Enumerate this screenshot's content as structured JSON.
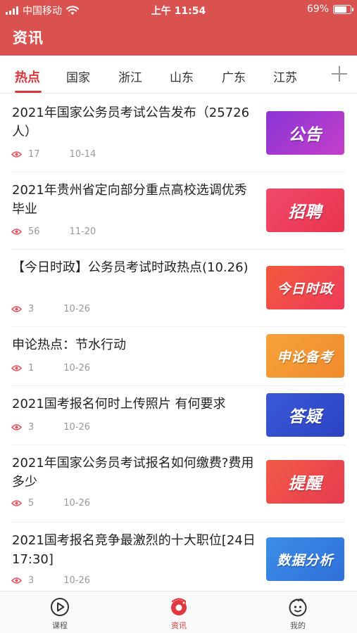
{
  "status_bar": {
    "carrier": "中国移动",
    "time": "上午 11:54",
    "battery_percent": "69%",
    "battery_level": 0.69,
    "icons": [
      "signal-icon",
      "wifi-icon",
      "battery-icon"
    ]
  },
  "header": {
    "title": "资讯",
    "background_color": "#d9524f"
  },
  "tabs": [
    {
      "label": "热点",
      "active": true
    },
    {
      "label": "国家"
    },
    {
      "label": "浙江"
    },
    {
      "label": "山东"
    },
    {
      "label": "广东"
    },
    {
      "label": "江苏"
    }
  ],
  "tabs_add_icon": "plus-icon",
  "accent_color": "#d9383a",
  "news": [
    {
      "title": "2021年国家公务员考试公告发布（25726人）",
      "views": "17",
      "date": "10-14",
      "thumb_text": "公告",
      "thumb_colors": [
        "#8a35d6",
        "#c43fc9"
      ]
    },
    {
      "title": "2021年贵州省定向部分重点高校选调优秀毕业",
      "views": "56",
      "date": "11-20",
      "thumb_text": "招聘",
      "thumb_colors": [
        "#f04a6a",
        "#e8344f"
      ]
    },
    {
      "title": "【今日时政】公务员考试时政热点(10.26)",
      "views": "3",
      "date": "10-26",
      "thumb_text": "今日时政",
      "thumb_colors": [
        "#f05a3c",
        "#ef3a5a"
      ]
    },
    {
      "title": "申论热点：节水行动",
      "views": "1",
      "date": "10-26",
      "thumb_text": "申论备考",
      "thumb_colors": [
        "#f7a23a",
        "#f08a2c"
      ]
    },
    {
      "title": "2021国考报名何时上传照片 有何要求",
      "views": "3",
      "date": "10-26",
      "thumb_text": "答疑",
      "thumb_colors": [
        "#3a59d8",
        "#2c43c2"
      ]
    },
    {
      "title": "2021年国家公务员考试报名如何缴费?费用多少",
      "views": "5",
      "date": "10-26",
      "thumb_text": "提醒",
      "thumb_colors": [
        "#f25a48",
        "#e63b50"
      ]
    },
    {
      "title": "2021国考报名竞争最激烈的十大职位[24日17:30]",
      "views": "3",
      "date": "10-26",
      "thumb_text": "数据分析",
      "thumb_colors": [
        "#3c8ee8",
        "#2f6fd9"
      ]
    }
  ],
  "bottom_nav": [
    {
      "label": "课程",
      "icon": "play-circle-icon"
    },
    {
      "label": "资讯",
      "icon": "news-icon",
      "active": true
    },
    {
      "label": "我的",
      "icon": "face-icon"
    }
  ]
}
